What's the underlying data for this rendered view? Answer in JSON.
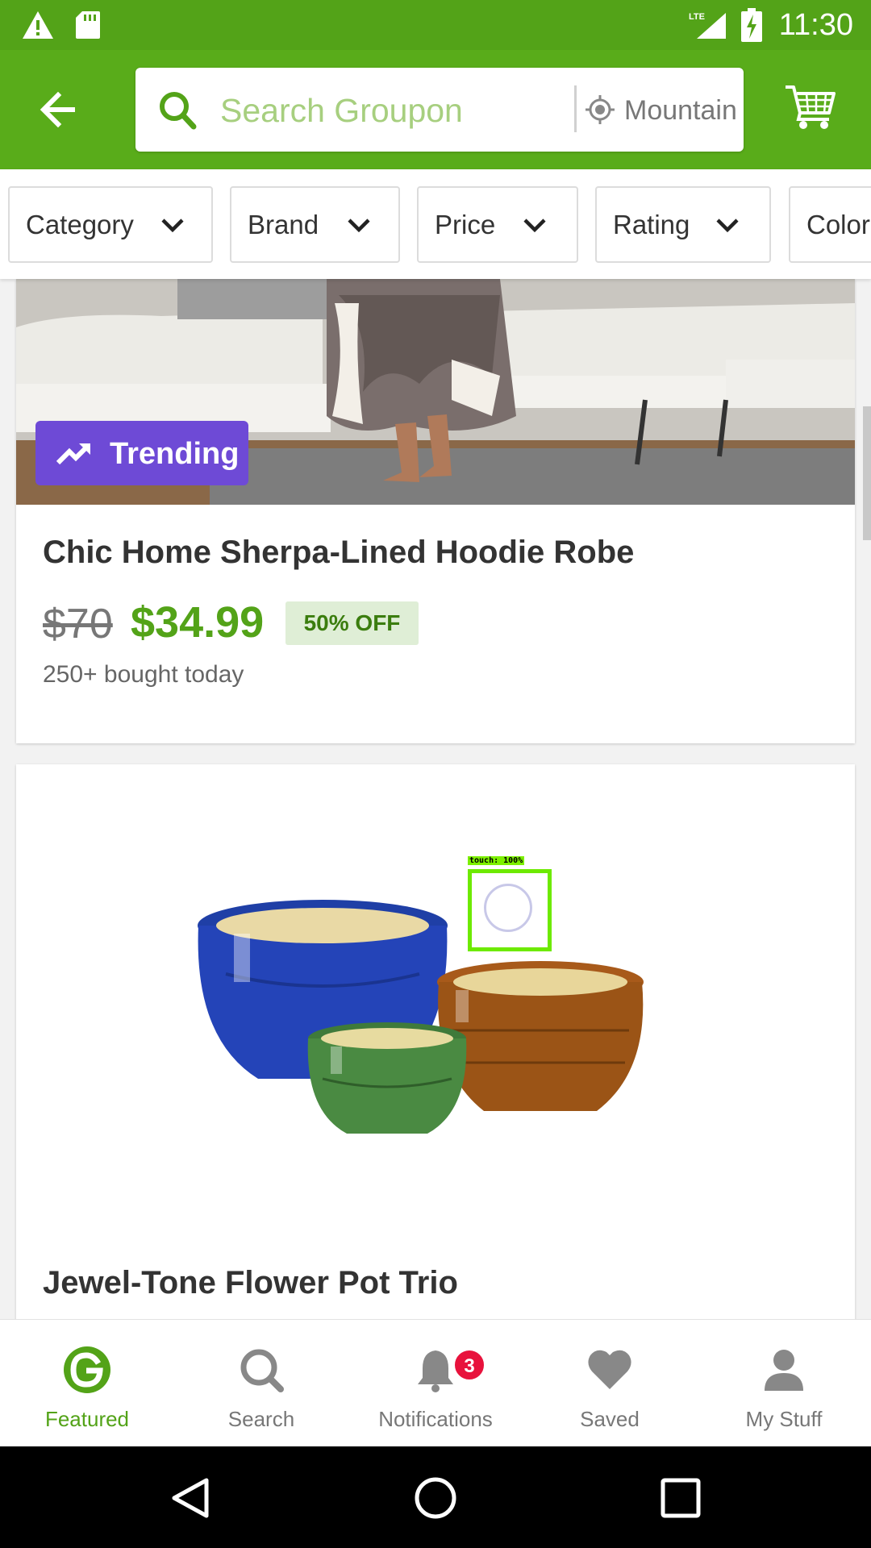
{
  "status_bar": {
    "time": "11:30",
    "network": "LTE"
  },
  "header": {
    "search_placeholder": "Search Groupon",
    "location": "Mountain View"
  },
  "filters": [
    {
      "label": "Category"
    },
    {
      "label": "Brand"
    },
    {
      "label": "Price"
    },
    {
      "label": "Rating"
    },
    {
      "label": "Color"
    }
  ],
  "deals": [
    {
      "badge": "Trending",
      "title": "Chic Home Sherpa-Lined Hoodie Robe",
      "original_price": "$70",
      "price": "$34.99",
      "discount": "50% OFF",
      "social_proof": "250+ bought today"
    },
    {
      "title": "Jewel-Tone Flower Pot Trio"
    }
  ],
  "touch_overlay": {
    "label": "touch: 100%"
  },
  "bottom_nav": [
    {
      "label": "Featured",
      "icon": "groupon-g-icon",
      "active": true
    },
    {
      "label": "Search",
      "icon": "search-icon"
    },
    {
      "label": "Notifications",
      "icon": "bell-icon",
      "badge": "3"
    },
    {
      "label": "Saved",
      "icon": "heart-icon"
    },
    {
      "label": "My Stuff",
      "icon": "person-icon"
    }
  ],
  "colors": {
    "brand_green": "#53a318",
    "trending_purple": "#6e4ad6",
    "badge_red": "#e8123c"
  }
}
